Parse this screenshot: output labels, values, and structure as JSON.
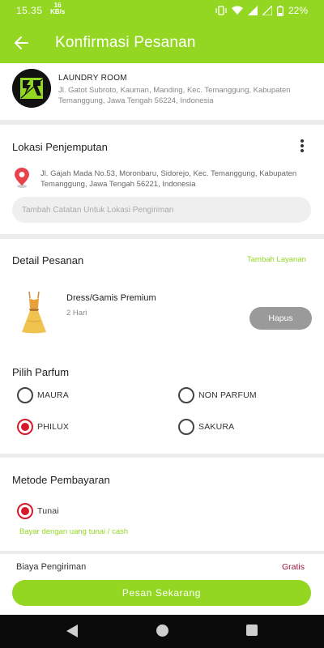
{
  "status_bar": {
    "time": "15.35",
    "net_speed_value": "16",
    "net_speed_unit": "KB/s",
    "battery": "22%"
  },
  "app_bar": {
    "title": "Konfirmasi Pesanan"
  },
  "laundry": {
    "name": "LAUNDRY ROOM",
    "address": "Jl. Gatot Subroto, Kauman, Manding, Kec. Temanggung, Kabupaten Temanggung, Jawa Tengah 56224, Indonesia"
  },
  "pickup": {
    "title": "Lokasi Penjemputan",
    "address": "Jl. Gajah Mada No.53, Moronbaru, Sidorejo, Kec. Temanggung, Kabupaten Temanggung, Jawa Tengah 56221, Indonesia",
    "note_placeholder": "Tambah Catatan Untuk Lokasi Pengiriman"
  },
  "order_detail": {
    "title": "Detail Pesanan",
    "add_service": "Tambah Layanan",
    "item": {
      "name": "Dress/Gamis Premium",
      "duration": "2 Hari",
      "remove_label": "Hapus"
    }
  },
  "perfume": {
    "title": "Pilih Parfum",
    "options": [
      {
        "label": "MAURA",
        "checked": false
      },
      {
        "label": "NON PARFUM",
        "checked": false
      },
      {
        "label": "PHILUX",
        "checked": true
      },
      {
        "label": "SAKURA",
        "checked": false
      }
    ]
  },
  "payment": {
    "title": "Metode Pembayaran",
    "options": [
      {
        "label": "Tunai",
        "checked": true
      }
    ],
    "note": "Bayar dengan uang tunai / cash"
  },
  "shipping": {
    "label": "Biaya Pengiriman",
    "value": "Gratis"
  },
  "submit_label": "Pesan Sekarang",
  "colors": {
    "accent": "#94d723",
    "radio_checked": "#d61a2a",
    "shipping_value": "#a0183a"
  }
}
